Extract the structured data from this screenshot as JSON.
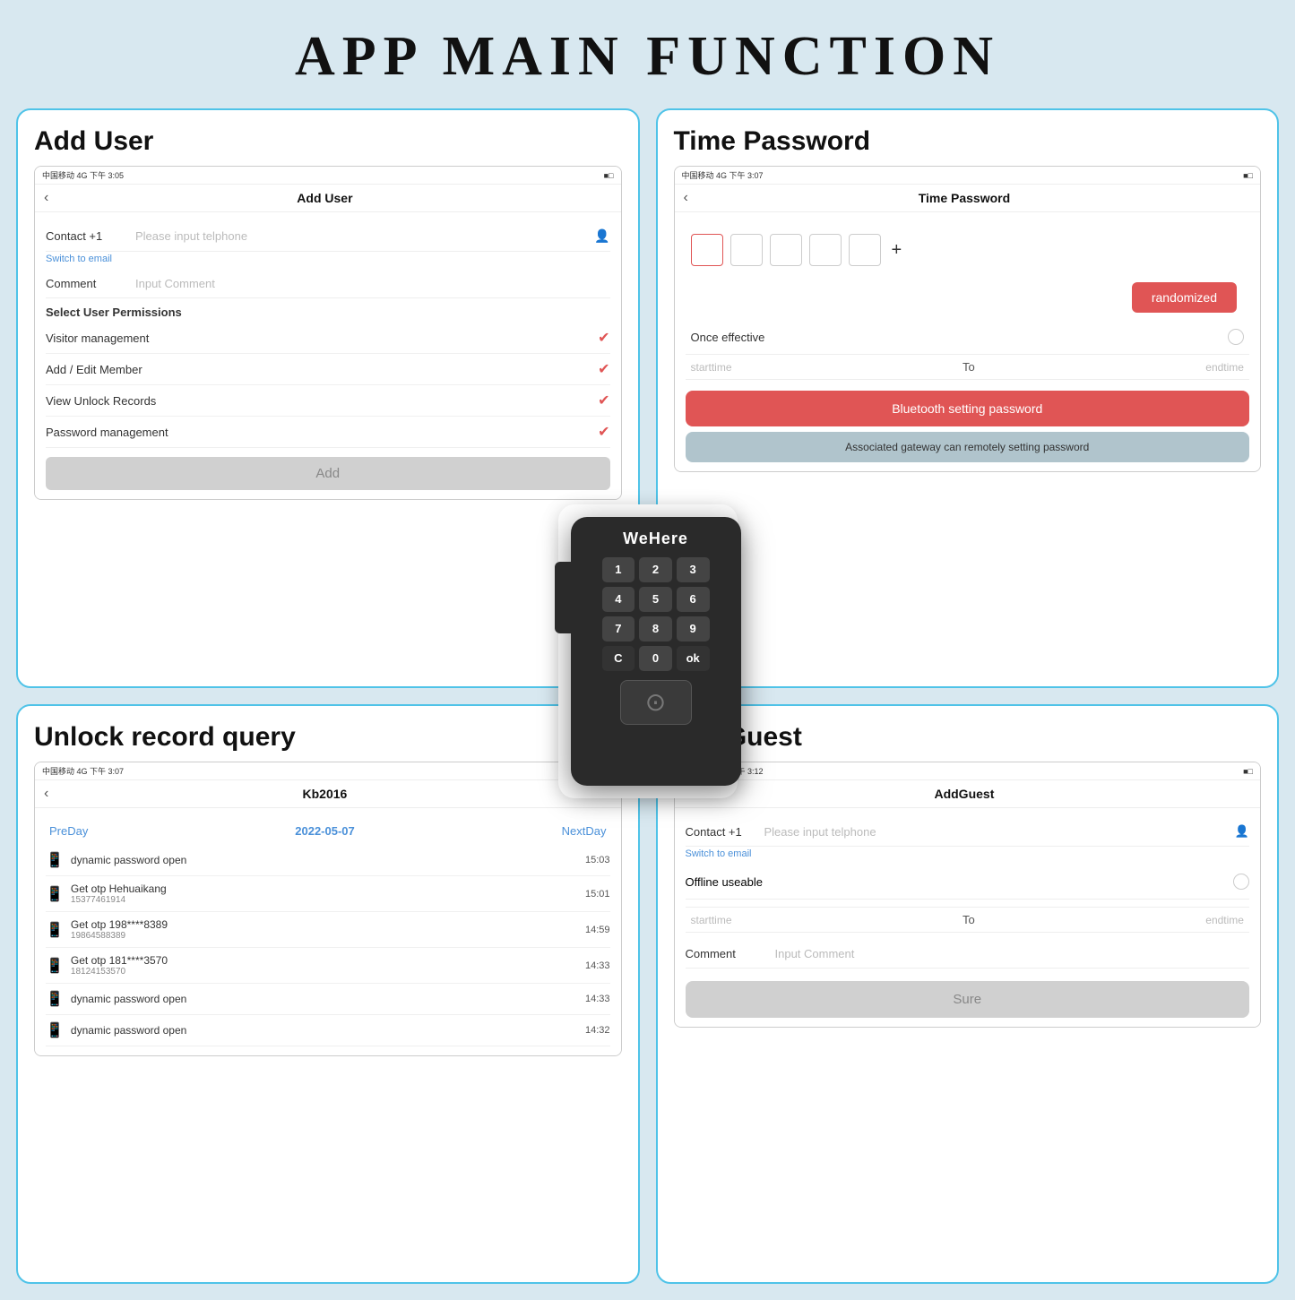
{
  "page": {
    "title": "APP MAIN FUNCTION",
    "bg_color": "#d8e8f0"
  },
  "panels": {
    "add_user": {
      "title": "Add User",
      "status_bar": "中国移动  4G   下午 3:05",
      "nav_title": "Add User",
      "contact_label": "Contact  +1",
      "contact_placeholder": "Please input telphone",
      "switch_email": "Switch to email",
      "comment_label": "Comment",
      "comment_placeholder": "Input Comment",
      "select_permissions": "Select User Permissions",
      "permissions": [
        {
          "name": "Visitor management",
          "checked": true
        },
        {
          "name": "Add / Edit Member",
          "checked": true
        },
        {
          "name": "View Unlock Records",
          "checked": true
        },
        {
          "name": "Password management",
          "checked": true
        }
      ],
      "add_btn": "Add"
    },
    "time_password": {
      "title": "Time Password",
      "status_bar": "中国移动  4G   下午 3:07",
      "nav_title": "Time Password",
      "randomized_btn": "randomized",
      "once_effective": "Once effective",
      "starttime": "starttime",
      "to": "To",
      "endtime": "endtime",
      "bt_btn": "Bluetooth setting password",
      "gateway_btn": "Associated gateway can remotely setting password"
    },
    "unlock_record": {
      "title": "Unlock record query",
      "status_bar": "中国移动  4G   下午 3:07",
      "nav_title": "Kb2016",
      "prev_day": "PreDay",
      "date": "2022-05-07",
      "next_day": "NextDay",
      "records": [
        {
          "title": "dynamic password open",
          "sub": "",
          "time": "15:03"
        },
        {
          "title": "Get otp Hehuaikang",
          "sub": "15377461914",
          "time": "15:01"
        },
        {
          "title": "Get otp 198****8389",
          "sub": "19864588389",
          "time": "14:59"
        },
        {
          "title": "Get otp 181****3570",
          "sub": "18124153570",
          "time": "14:33"
        },
        {
          "title": "dynamic password open",
          "sub": "",
          "time": "14:33"
        },
        {
          "title": "dynamic password open",
          "sub": "",
          "time": "14:32"
        }
      ]
    },
    "add_guest": {
      "title": "AddGuest",
      "status_bar": "中国移动  4G   下午 3:12",
      "nav_title": "AddGuest",
      "contact_label": "Contact  +1",
      "contact_placeholder": "Please input telphone",
      "switch_email": "Switch to email",
      "offline_label": "Offline useable",
      "starttime": "starttime",
      "to": "To",
      "endtime": "endtime",
      "comment_label": "Comment",
      "comment_placeholder": "Input Comment",
      "sure_btn": "Sure"
    }
  },
  "device": {
    "brand": "WeHere",
    "keys": [
      "1",
      "2",
      "3",
      "4",
      "5",
      "6",
      "7",
      "8",
      "9",
      "C",
      "0",
      "ok"
    ]
  }
}
